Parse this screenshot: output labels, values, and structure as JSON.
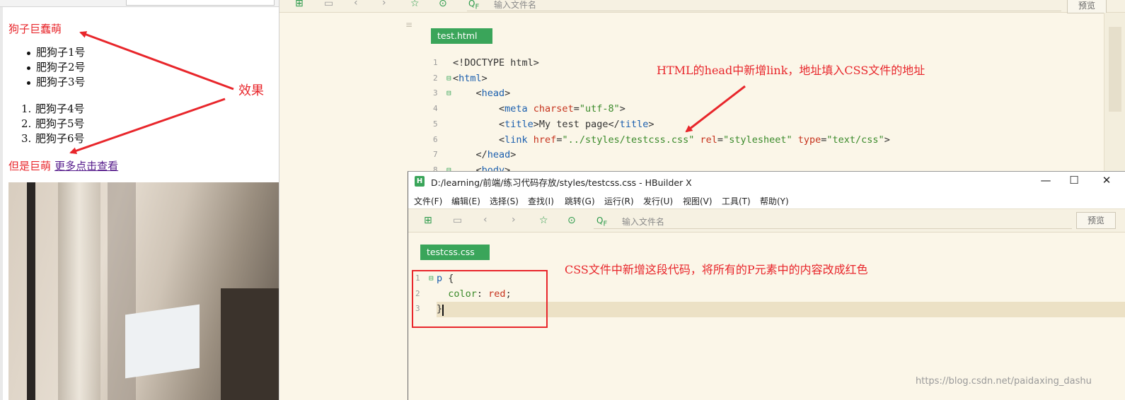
{
  "browser_preview": {
    "title": "狗子巨蠢萌",
    "unordered_list": [
      "肥狗子1号",
      "肥狗子2号",
      "肥狗子3号"
    ],
    "ordered_list": [
      {
        "num": "1.",
        "text": "肥狗子4号"
      },
      {
        "num": "2.",
        "text": "肥狗子5号"
      },
      {
        "num": "3.",
        "text": "肥狗子6号"
      }
    ],
    "footer_text": "但是巨萌",
    "footer_link": "更多点击查看"
  },
  "main_editor": {
    "search_placeholder": "输入文件名",
    "preview_label": "预览",
    "tab": "test.html",
    "code_lines": [
      {
        "n": "1",
        "fold": "",
        "parts": [
          {
            "t": "<!DOCTYPE html>",
            "c": "plain"
          }
        ]
      },
      {
        "n": "2",
        "fold": "⊟",
        "parts": [
          {
            "t": "<",
            "c": "br"
          },
          {
            "t": "html",
            "c": "tag"
          },
          {
            "t": ">",
            "c": "br"
          }
        ]
      },
      {
        "n": "3",
        "fold": "⊟",
        "parts": [
          {
            "t": "    <",
            "c": "br"
          },
          {
            "t": "head",
            "c": "tag"
          },
          {
            "t": ">",
            "c": "br"
          }
        ]
      },
      {
        "n": "4",
        "fold": "",
        "parts": [
          {
            "t": "        <",
            "c": "br"
          },
          {
            "t": "meta ",
            "c": "tag"
          },
          {
            "t": "charset",
            "c": "attr"
          },
          {
            "t": "=",
            "c": "br"
          },
          {
            "t": "\"utf-8\"",
            "c": "str"
          },
          {
            "t": ">",
            "c": "br"
          }
        ]
      },
      {
        "n": "5",
        "fold": "",
        "parts": [
          {
            "t": "        <",
            "c": "br"
          },
          {
            "t": "title",
            "c": "tag"
          },
          {
            "t": ">My test page</",
            "c": "br"
          },
          {
            "t": "title",
            "c": "tag"
          },
          {
            "t": ">",
            "c": "br"
          }
        ]
      },
      {
        "n": "6",
        "fold": "",
        "parts": [
          {
            "t": "        <",
            "c": "br"
          },
          {
            "t": "link ",
            "c": "tag"
          },
          {
            "t": "href",
            "c": "attr"
          },
          {
            "t": "=",
            "c": "br"
          },
          {
            "t": "\"../styles/testcss.css\"",
            "c": "str"
          },
          {
            "t": " ",
            "c": "br"
          },
          {
            "t": "rel",
            "c": "attr"
          },
          {
            "t": "=",
            "c": "br"
          },
          {
            "t": "\"stylesheet\"",
            "c": "str"
          },
          {
            "t": " ",
            "c": "br"
          },
          {
            "t": "type",
            "c": "attr"
          },
          {
            "t": "=",
            "c": "br"
          },
          {
            "t": "\"text/css\"",
            "c": "str"
          },
          {
            "t": ">",
            "c": "br"
          }
        ]
      },
      {
        "n": "7",
        "fold": "",
        "parts": [
          {
            "t": "    </",
            "c": "br"
          },
          {
            "t": "head",
            "c": "tag"
          },
          {
            "t": ">",
            "c": "br"
          }
        ]
      },
      {
        "n": "8",
        "fold": "⊟",
        "parts": [
          {
            "t": "    <",
            "c": "br"
          },
          {
            "t": "body",
            "c": "tag"
          },
          {
            "t": ">",
            "c": "br"
          }
        ]
      }
    ]
  },
  "css_window": {
    "title": "D:/learning/前端/练习代码存放/styles/testcss.css - HBuilder X",
    "logo": "H",
    "menu": [
      "文件(F)",
      "编辑(E)",
      "选择(S)",
      "查找(I)",
      "跳转(G)",
      "运行(R)",
      "发行(U)",
      "视图(V)",
      "工具(T)",
      "帮助(Y)"
    ],
    "search_placeholder": "输入文件名",
    "preview_label": "预览",
    "tab": "testcss.css",
    "code_lines": [
      {
        "n": "1",
        "fold": "⊟",
        "parts": [
          {
            "t": "p",
            "c": "tag"
          },
          {
            "t": " {",
            "c": "br"
          }
        ]
      },
      {
        "n": "2",
        "fold": "",
        "parts": [
          {
            "t": "  color",
            "c": "str"
          },
          {
            "t": ": ",
            "c": "br"
          },
          {
            "t": "red",
            "c": "attr"
          },
          {
            "t": ";",
            "c": "br"
          }
        ]
      },
      {
        "n": "3",
        "fold": "",
        "parts": [
          {
            "t": "}",
            "c": "br"
          }
        ]
      }
    ]
  },
  "annotations": {
    "effect": "效果",
    "html_note": "HTML的head中新增link，地址填入CSS文件的地址",
    "css_note": "CSS文件中新增这段代码，将所有的P元素中的内容改成红色"
  },
  "watermark": "https://blog.csdn.net/paidaxing_dashu",
  "colors": {
    "annotation_red": "#e8262b",
    "tab_green": "#3aa55a",
    "editor_bg": "#fbf6e8",
    "link_purple": "#551a8b"
  },
  "icons": [
    "new-file-icon",
    "save-icon",
    "back-icon",
    "forward-icon",
    "star-icon",
    "run-icon",
    "search-icon",
    "minimize-icon",
    "maximize-icon",
    "close-icon"
  ]
}
